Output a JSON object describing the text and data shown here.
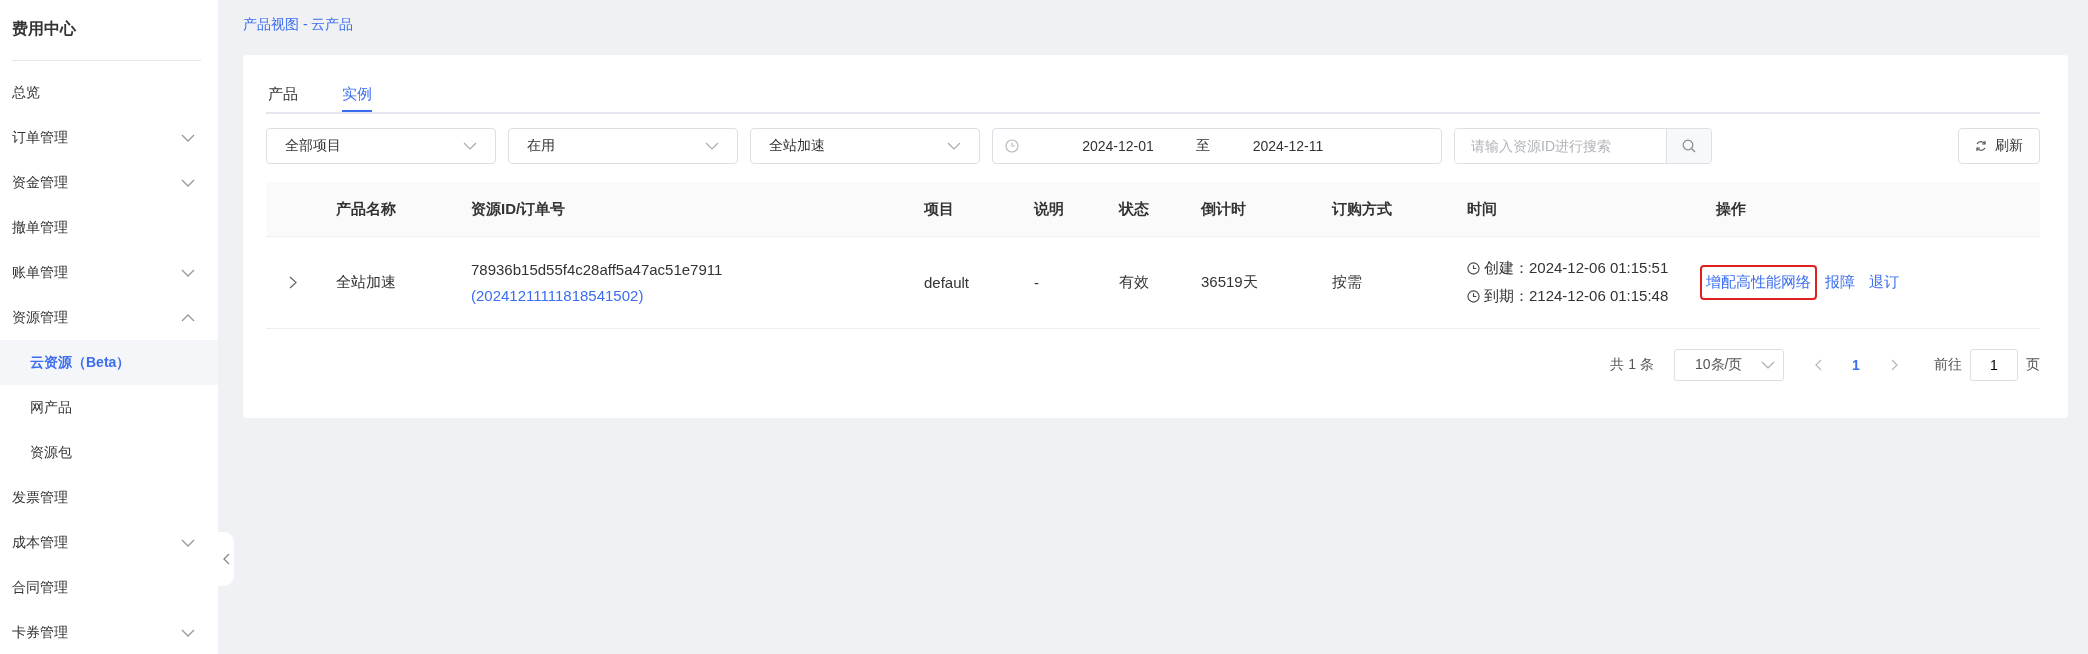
{
  "sidebar": {
    "title": "费用中心",
    "items": [
      {
        "label": "总览"
      },
      {
        "label": "订单管理",
        "expanded": false
      },
      {
        "label": "资金管理",
        "expanded": false
      },
      {
        "label": "撤单管理"
      },
      {
        "label": "账单管理",
        "expanded": false
      },
      {
        "label": "资源管理",
        "expanded": true,
        "children": [
          {
            "label": "云资源（Beta）",
            "selected": true
          },
          {
            "label": "网产品",
            "selected": false
          },
          {
            "label": "资源包",
            "selected": false
          }
        ]
      },
      {
        "label": "发票管理"
      },
      {
        "label": "成本管理",
        "expanded": false
      },
      {
        "label": "合同管理"
      },
      {
        "label": "卡券管理",
        "expanded": false
      }
    ]
  },
  "breadcrumb": "产品视图 - 云产品",
  "tabs": [
    {
      "label": "产品",
      "selected": false
    },
    {
      "label": "实例",
      "selected": true
    }
  ],
  "filters": {
    "selects": [
      {
        "value": "全部项目"
      },
      {
        "value": "在用"
      },
      {
        "value": "全站加速"
      }
    ],
    "date_range": {
      "start": "2024-12-01",
      "separator": "至",
      "end": "2024-12-11"
    },
    "search": {
      "placeholder": "请输入资源ID进行搜索"
    },
    "refresh_button": "刷新"
  },
  "table": {
    "columns": [
      "产品名称",
      "资源ID/订单号",
      "项目",
      "说明",
      "状态",
      "倒计时",
      "订购方式",
      "时间",
      "操作"
    ],
    "rows": [
      {
        "expanded": false,
        "product": "全站加速",
        "resource_id": "78936b15d55f4c28aff5a47ac51e7911",
        "order_no": "(20241211111818541502)",
        "project": "default",
        "note": "-",
        "status": "有效",
        "countdown": "36519天",
        "purchase": "按需",
        "created": "创建：2024-12-06 01:15:51",
        "expires": "到期：2124-12-06 01:15:48",
        "actions": [
          {
            "label": "增配高性能网络",
            "highlighted": true
          },
          {
            "label": "报障",
            "highlighted": false
          },
          {
            "label": "退订",
            "highlighted": false
          }
        ]
      }
    ]
  },
  "pagination": {
    "total": "共 1 条",
    "page_size": "10条/页",
    "pages": [
      {
        "label": "1",
        "selected": true
      }
    ],
    "goto_label": "前往",
    "goto_value": "1",
    "page_suffix": "页"
  }
}
